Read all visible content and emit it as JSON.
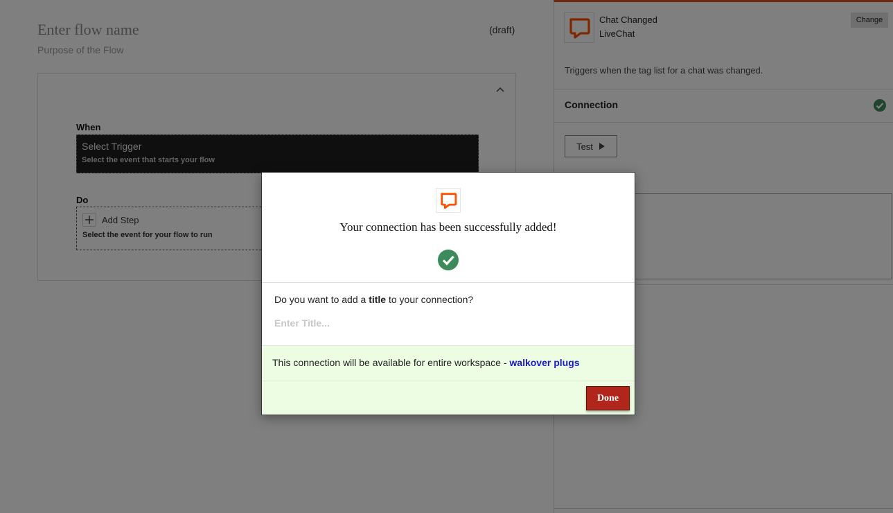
{
  "flow": {
    "name_placeholder": "Enter flow name",
    "status": "(draft)",
    "purpose_placeholder": "Purpose of the Flow",
    "when_label": "When",
    "trigger_title": "Select Trigger",
    "trigger_subtitle": "Select the event that starts your flow",
    "do_label": "Do",
    "add_step_label": "Add Step",
    "step_subtitle": "Select the event for your flow to run"
  },
  "panel": {
    "trigger_name": "Chat Changed",
    "app_name": "LiveChat",
    "change_label": "Change",
    "description": "Triggers when the tag list for a chat was changed.",
    "connection_label": "Connection",
    "test_label": "Test"
  },
  "modal": {
    "title": "Your connection has been successfully added!",
    "question_prefix": "Do you want to add a ",
    "question_bold": "title",
    "question_suffix": " to your connection?",
    "title_placeholder": "Enter Title...",
    "workspace_text": "This connection will be available for entire workspace - ",
    "workspace_name": "walkover plugs",
    "done_label": "Done"
  },
  "colors": {
    "accent_orange": "#d9531e",
    "livechat_orange": "#ff5100",
    "success_green": "#3d8b5a",
    "done_red": "#b0261b",
    "link_blue": "#1a1ad0",
    "workspace_bg": "#edfde3"
  },
  "icons": {
    "app_logo": "livechat-logo-icon",
    "check": "check-circle-icon",
    "collapse": "chevron-up-icon",
    "add": "plus-icon",
    "play": "play-icon"
  }
}
